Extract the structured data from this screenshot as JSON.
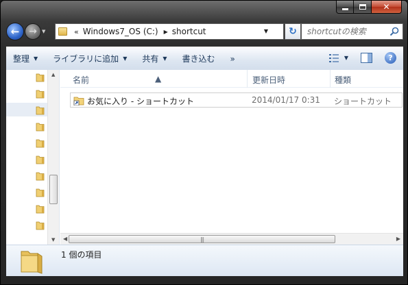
{
  "window": {
    "caption": {
      "minimize": "",
      "maximize": "",
      "close": "✕"
    }
  },
  "nav": {
    "back": "←",
    "forward": "→"
  },
  "address": {
    "overflow": "«",
    "crumbs": [
      "Windows7_OS (C:)",
      "shortcut"
    ]
  },
  "search": {
    "placeholder": "shortcutの検索"
  },
  "toolbar": {
    "organize": "整理",
    "include_in_library": "ライブラリに追加",
    "share": "共有",
    "burn": "書き込む",
    "more": "»"
  },
  "columns": {
    "name": "名前",
    "date_modified": "更新日時",
    "type": "種類"
  },
  "files": [
    {
      "name": "お気に入り - ショートカット",
      "date": "2014/01/17 0:31",
      "type": "ショートカット"
    }
  ],
  "details": {
    "item_count": "1 個の項目"
  },
  "icons": {
    "folder": "folder-icon",
    "shortcut": "shortcut-icon",
    "search": "search-icon",
    "help": "help-icon"
  }
}
